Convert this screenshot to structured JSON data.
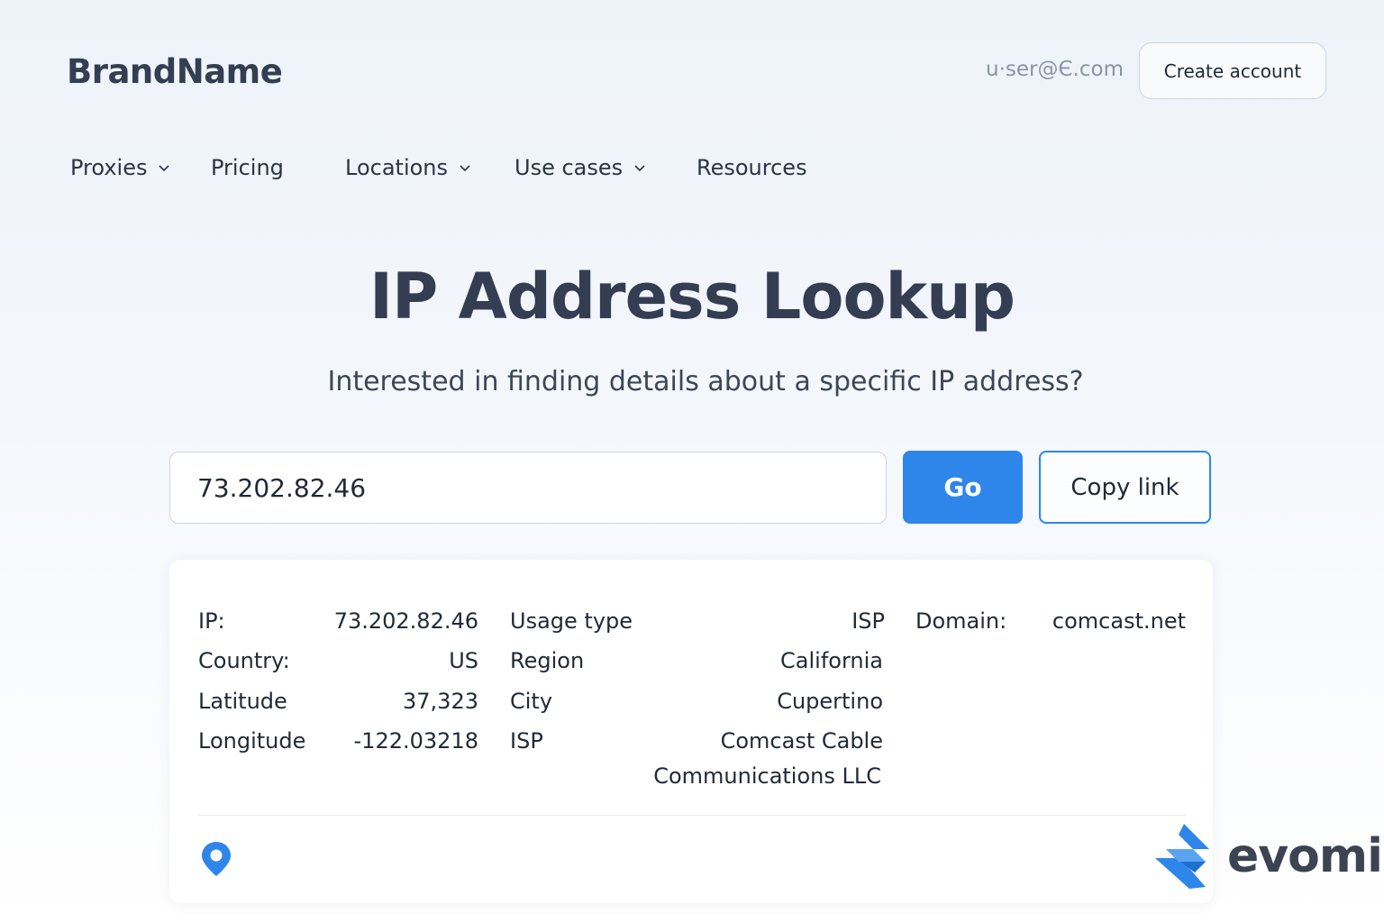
{
  "header": {
    "brand": "BrandName",
    "user_email": "u·ser@Є.com",
    "create_account_label": "Create account"
  },
  "nav": {
    "items": [
      {
        "label": "Proxies",
        "has_dropdown": true
      },
      {
        "label": "Pricing",
        "has_dropdown": false
      },
      {
        "label": "Locations",
        "has_dropdown": true
      },
      {
        "label": "Use cases",
        "has_dropdown": true
      },
      {
        "label": "Resources",
        "has_dropdown": false
      }
    ]
  },
  "hero": {
    "title": "IP Address Lookup",
    "subtitle": "Interested in finding details about a specific IP address?"
  },
  "search": {
    "value": "73.202.82.46",
    "go_label": "Go",
    "copy_label": "Copy link"
  },
  "results": {
    "ip_label": "IP:",
    "ip_value": "73.202.82.46",
    "country_label": "Country:",
    "country_value": "US",
    "latitude_label": "Latitude",
    "latitude_value": "37,323",
    "longitude_label": "Longitude",
    "longitude_value": "-122.03218",
    "usage_label": "Usage type",
    "usage_value": "ISP",
    "region_label": "Region",
    "region_value": "California",
    "city_label": "City",
    "city_value": "Cupertino",
    "isp_label": "ISP",
    "isp_value_line1": "Comcast Cable",
    "isp_value_line2": "Communications LLC",
    "domain_label": "Domain:",
    "domain_value": "comcast.net"
  },
  "logo": {
    "word": "evomi"
  },
  "colors": {
    "accent": "#2e86ea",
    "title": "#343d52",
    "text": "#222a38",
    "muted": "#8a94a6"
  },
  "icons": {
    "dropdown": "chevron-down-icon",
    "location": "map-pin-icon",
    "logo_mark": "evomi-logo-mark"
  }
}
